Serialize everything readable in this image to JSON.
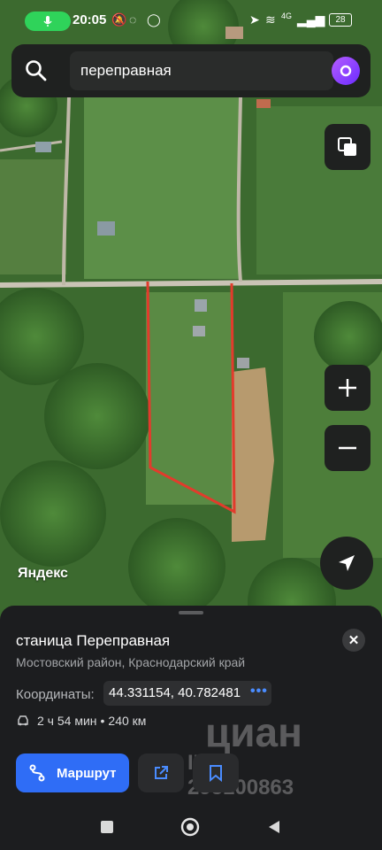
{
  "status_bar": {
    "time": "20:05",
    "network": "4G",
    "battery": "28"
  },
  "search": {
    "query": "переправная"
  },
  "map": {
    "logo": "Яндекс"
  },
  "place": {
    "title": "станица Переправная",
    "subtitle": "Мостовский район, Краснодарский край",
    "coords_label": "Координаты:",
    "coords_value": "44.331154, 40.782481",
    "route_time": "2 ч 54 мин",
    "route_separator": "•",
    "route_distance": "240 км",
    "route_button": "Маршрут"
  },
  "watermark": {
    "brand": "циан",
    "id": "ID 295100863"
  },
  "icons": {
    "search": "search-icon",
    "alice": "alice-icon",
    "layers": "layers-icon",
    "zoom_in": "plus-icon",
    "zoom_out": "minus-icon",
    "locate": "navigation-arrow-icon",
    "close": "close-icon",
    "more": "more-dots-icon",
    "car": "car-icon",
    "route": "route-icon",
    "share": "share-icon",
    "bookmark": "bookmark-icon"
  },
  "colors": {
    "accent": "#2f6df6",
    "plot_outline": "#e23b2c",
    "sheet_bg": "#1c1d1f"
  }
}
